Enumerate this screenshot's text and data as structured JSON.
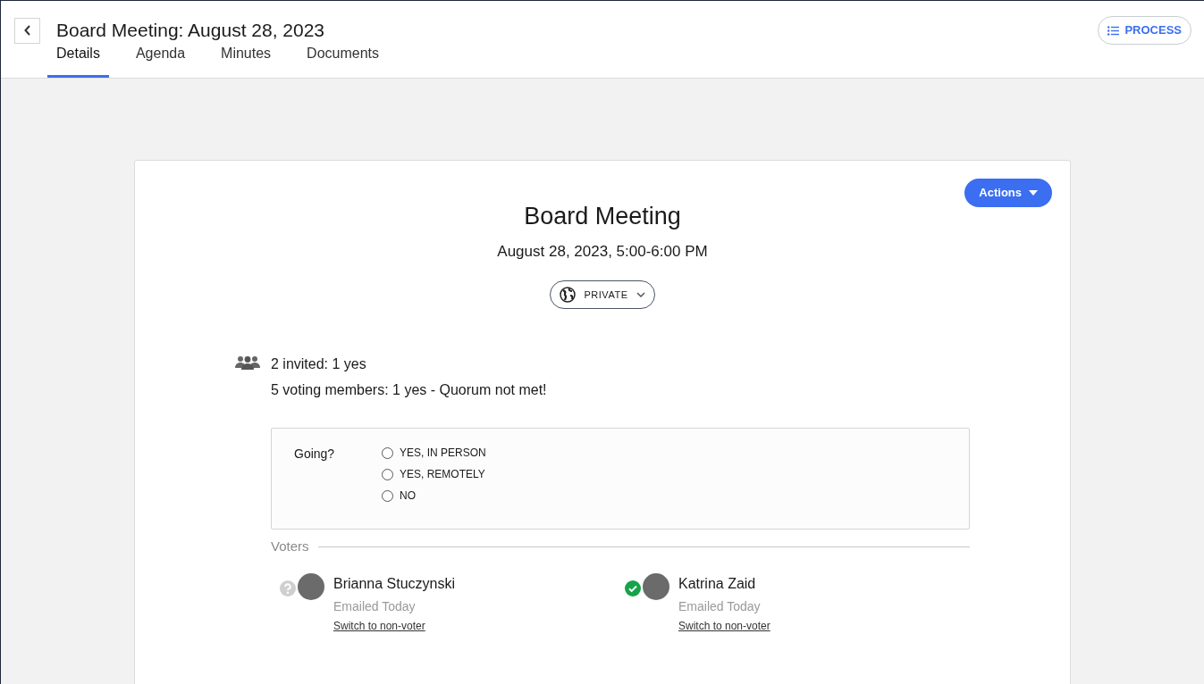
{
  "header": {
    "title": "Board Meeting: August 28, 2023",
    "process_button": "PROCESS"
  },
  "tabs": [
    {
      "label": "Details",
      "selected": true
    },
    {
      "label": "Agenda",
      "selected": false
    },
    {
      "label": "Minutes",
      "selected": false
    },
    {
      "label": "Documents",
      "selected": false
    }
  ],
  "meeting": {
    "actions_button": "Actions",
    "title": "Board Meeting",
    "datetime": "August 28, 2023, 5:00-6:00 PM",
    "visibility": "PRIVATE"
  },
  "attendance": {
    "invited": "2 invited: 1 yes",
    "voting": "5 voting members: 1 yes - Quorum not met!"
  },
  "rsvp": {
    "label": "Going?",
    "options": [
      {
        "label": "YES, IN PERSON",
        "selected": false
      },
      {
        "label": "YES, REMOTELY",
        "selected": false
      },
      {
        "label": "NO",
        "selected": false
      }
    ]
  },
  "voters": {
    "heading": "Voters",
    "items": [
      {
        "name": "Brianna Stuczynski",
        "kind": "unknown",
        "note": "Emailed Today",
        "link": "Switch to non-voter"
      },
      {
        "name": "Katrina Zaid",
        "kind": "yes",
        "note": "Emailed Today",
        "link": "Switch to non-voter"
      }
    ]
  }
}
